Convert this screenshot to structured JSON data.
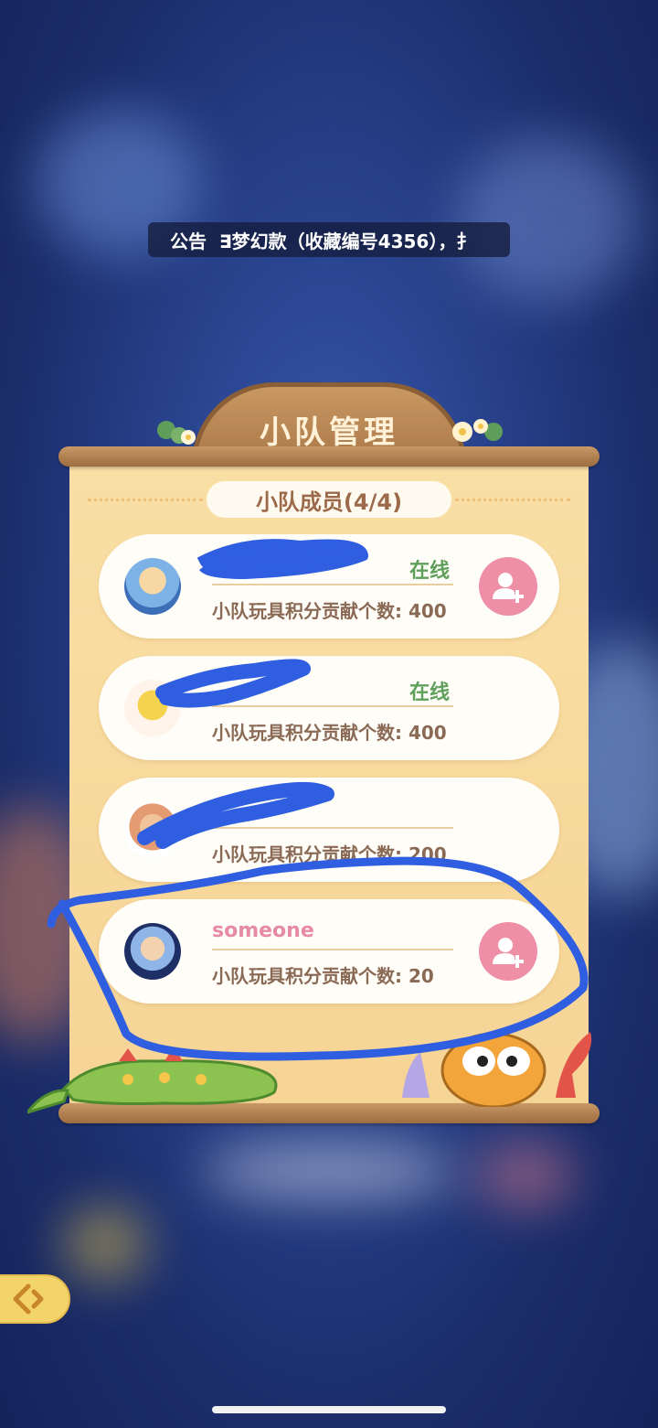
{
  "notice": {
    "tag": "公告",
    "message": "∃梦幻款（收藏编号4356），扌"
  },
  "panel": {
    "title": "小队管理",
    "section_label": "小队成员(4/4)"
  },
  "members": [
    {
      "name": "",
      "status": "在线",
      "score_text": "小队玩具积分贡献个数: 400",
      "show_add": true
    },
    {
      "name": "",
      "status": "在线",
      "score_text": "小队玩具积分贡献个数: 400",
      "show_add": false
    },
    {
      "name": "",
      "status": "",
      "score_text": "小队玩具积分贡献个数: 200",
      "show_add": false
    },
    {
      "name": "someone",
      "status": "",
      "score_text": "小队玩具积分贡献个数: 20",
      "show_add": true
    }
  ],
  "colors": {
    "accent_pink": "#ee8fa6",
    "online_green": "#5fa05a",
    "board_wood": "#a97848",
    "paper": "#f8d99c"
  },
  "icons": {
    "add_friend": "add-friend-icon",
    "side": "back-arrow-icon"
  }
}
